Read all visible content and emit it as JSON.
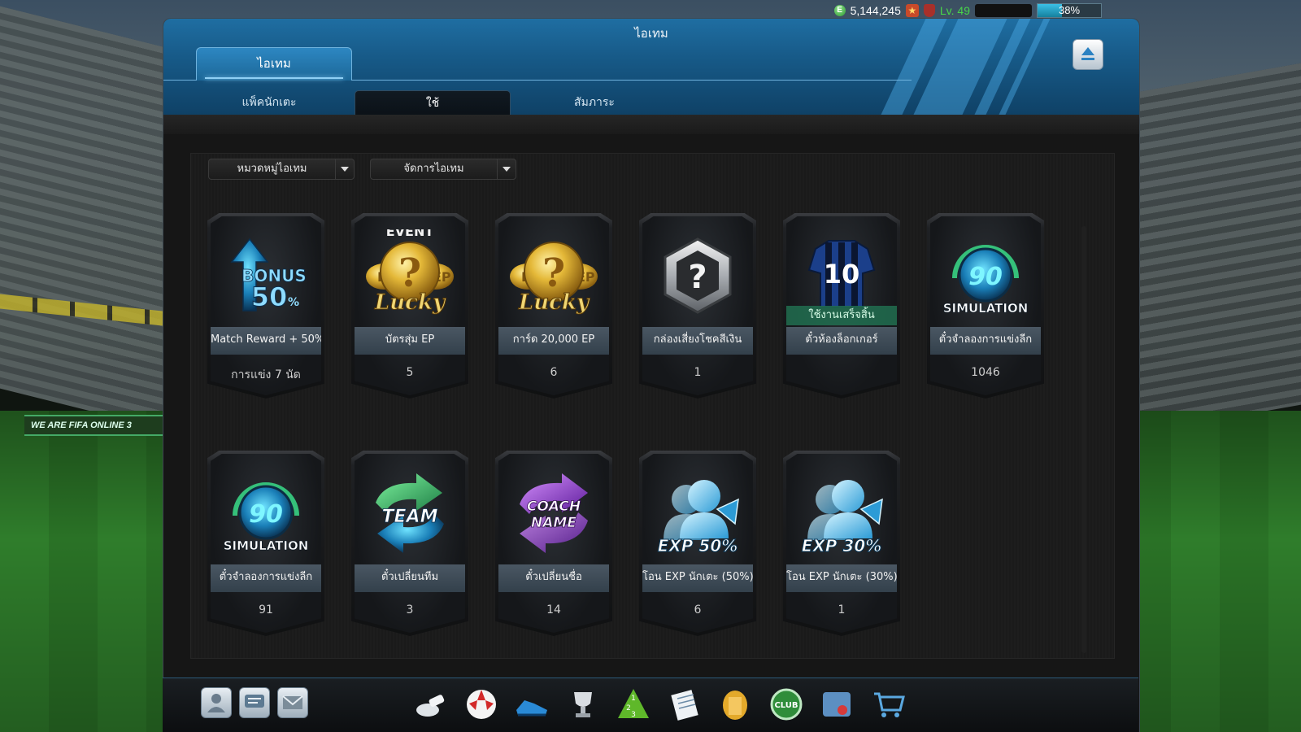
{
  "status_bar": {
    "ep": "5,144,245",
    "level": "Lv. 49",
    "exp_percent": 38,
    "exp_label": "38%"
  },
  "window": {
    "title": "ไอเทม",
    "top_tab": "ไอเทม",
    "sub_tabs": [
      "แพ็คนักเตะ",
      "ใช้",
      "สัมภาระ"
    ],
    "active_sub_tab": "ใช้"
  },
  "filters": {
    "category": "หมวดหมู่ไอเทม",
    "manage": "จัดการไอเทม"
  },
  "items": [
    {
      "name": "Match Reward + 50%",
      "count": "การแข่ง 7 นัด",
      "icon": "bonus-50-icon"
    },
    {
      "name": "บัตรสุ่ม EP",
      "count": "5",
      "icon": "event-lucky-ep-icon",
      "badge": "EVENT"
    },
    {
      "name": "การ์ด 20,000 EP",
      "count": "6",
      "icon": "lucky-ep-icon"
    },
    {
      "name": "กล่องเสี่ยงโชคสีเงิน",
      "count": "1",
      "icon": "silver-mystery-box-icon"
    },
    {
      "name": "ตั๋วห้องล็อกเกอร์",
      "count": "",
      "icon": "locker-jersey-icon",
      "status": "ใช้งานเสร็จสิ้น"
    },
    {
      "name": "ตั๋วจำลองการแข่งลีก",
      "count": "1046",
      "icon": "simulation-90-icon"
    },
    {
      "name": "ตั๋วจำลองการแข่งลีก",
      "count": "91",
      "icon": "simulation-90-icon"
    },
    {
      "name": "ตั๋วเปลี่ยนทีม",
      "count": "3",
      "icon": "team-change-icon"
    },
    {
      "name": "ตั๋วเปลี่ยนชื่อ",
      "count": "14",
      "icon": "coach-name-icon"
    },
    {
      "name": "โอน EXP นักเตะ (50%)",
      "count": "6",
      "icon": "exp-50-icon"
    },
    {
      "name": "โอน EXP นักเตะ (30%)",
      "count": "1",
      "icon": "exp-30-icon"
    }
  ],
  "item_art_text": {
    "bonus": "BONUS",
    "bonus_pct": "50",
    "pct": "%",
    "event": "EVENT",
    "lucky": "Lucky",
    "ep": "EP",
    "e": "E",
    "q": "?",
    "jersey_number": "10",
    "sim_number": "90",
    "simulation": "SIMULATION",
    "team": "TEAM",
    "coach": "COACH",
    "name": "NAME",
    "exp50": "EXP 50%",
    "exp30": "EXP 30%"
  },
  "dock": {
    "left_buttons": [
      "profile-icon",
      "chat-icon",
      "mail-icon"
    ],
    "icons": [
      "whistle-icon",
      "ball-icon",
      "boots-icon",
      "trophy-icon",
      "ranking-icon",
      "notepad-icon",
      "shirt-icon",
      "club-icon",
      "manager-card-icon",
      "shop-cart-icon"
    ]
  },
  "colors": {
    "header_blue": "#1f6ea2",
    "level_green": "#47d54a",
    "exp_bar": "#3bc0e6",
    "gold": "#d9a928"
  }
}
